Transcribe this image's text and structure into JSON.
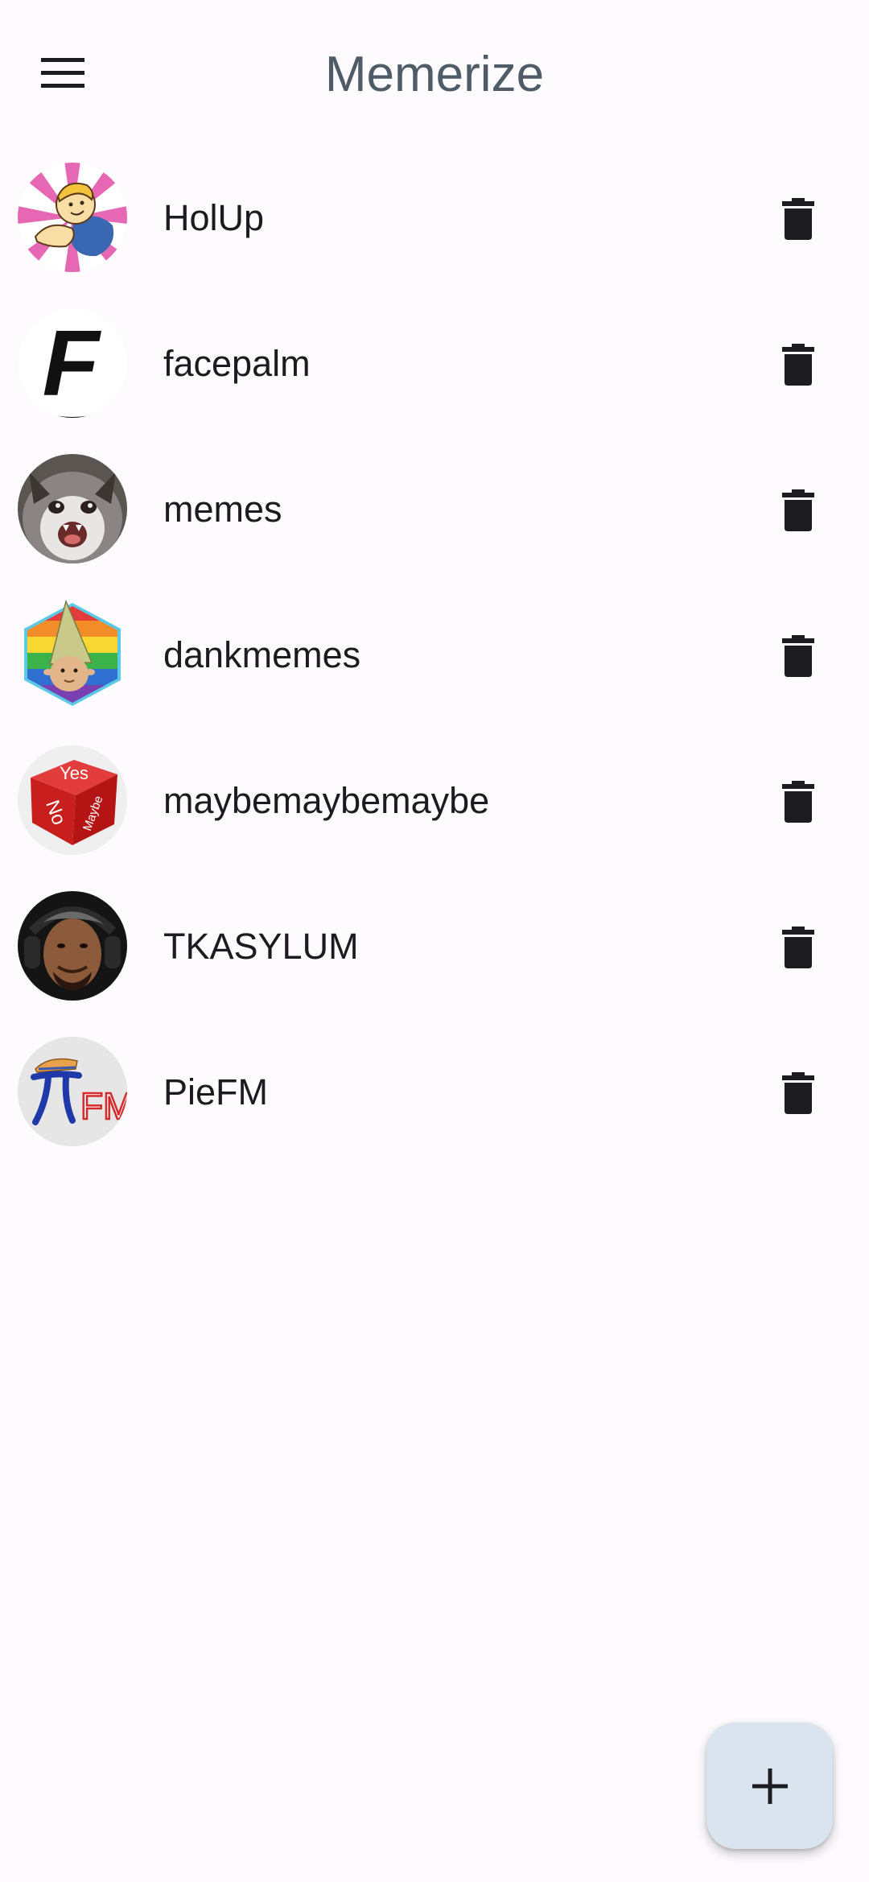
{
  "app_bar": {
    "title": "Memerize",
    "menu_icon": "hamburger-menu-icon"
  },
  "subscriptions": [
    {
      "name": "HolUp",
      "avatar": "holup-avatar"
    },
    {
      "name": "facepalm",
      "avatar": "facepalm-avatar"
    },
    {
      "name": "memes",
      "avatar": "memes-avatar"
    },
    {
      "name": "dankmemes",
      "avatar": "dankmemes-avatar"
    },
    {
      "name": "maybemaybemaybe",
      "avatar": "maybemaybemaybe-avatar"
    },
    {
      "name": "TKASYLUM",
      "avatar": "tkasylum-avatar"
    },
    {
      "name": "PieFM",
      "avatar": "piefm-avatar"
    }
  ],
  "dice_labels": {
    "yes": "Yes",
    "no": "No",
    "maybe": "Maybe"
  },
  "piefm_logo_text": "FM",
  "facepalm_logo_letter": "F",
  "row_action_icon": "trash-icon",
  "fab": {
    "icon": "plus-icon"
  },
  "colors": {
    "background": "#fdfbfd",
    "title": "#4f5b66",
    "fab_background": "#d9e4ef",
    "icon": "#1c1b1f"
  }
}
